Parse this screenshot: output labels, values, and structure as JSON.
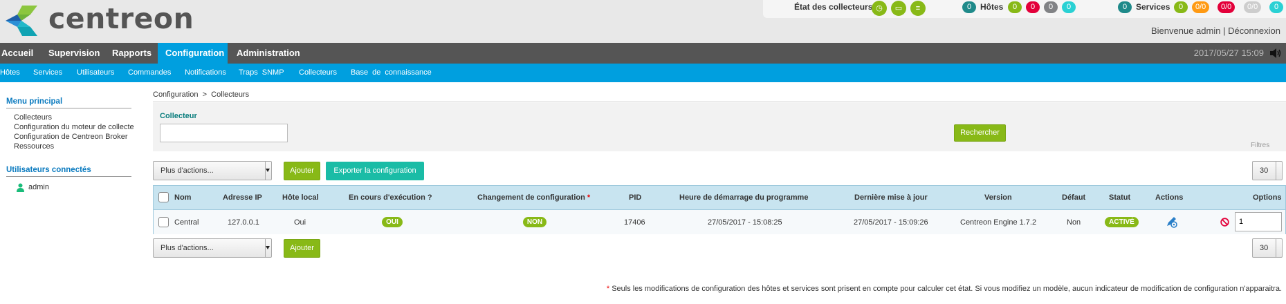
{
  "app": {
    "logo_text": "centreon"
  },
  "status": {
    "collectors_label": "État des collecteurs",
    "collector_icons": [
      "clock-icon",
      "inbox-icon",
      "database-icon"
    ],
    "hosts": {
      "label": "Hôtes",
      "total": "0",
      "up": "0",
      "down": "0",
      "unreachable": "0",
      "pending": "0"
    },
    "services": {
      "label": "Services",
      "total": "0",
      "ok": "0",
      "warning": "0/0",
      "critical": "0/0",
      "unknown": "0/0",
      "pending": "0"
    },
    "colors": {
      "green": "#88b917",
      "red": "#e3003a",
      "orange": "#ff9a13",
      "grey": "#818285",
      "light_grey": "#cdcdcd",
      "cyan": "#2ad1d4",
      "teal": "#1f8a8a"
    }
  },
  "user": {
    "welcome": "Bienvenue admin",
    "separator": "|",
    "logout": "Déconnexion"
  },
  "mainnav": {
    "items": [
      "Accueil",
      "Supervision",
      "Rapports",
      "Configuration",
      "Administration"
    ],
    "active": "Configuration",
    "datetime": "2017/05/27 15:09"
  },
  "subnav": {
    "items": [
      "Hôtes",
      "Services",
      "Utilisateurs",
      "Commandes",
      "Notifications",
      "Traps SNMP",
      "Collecteurs",
      "Base de connaissance"
    ]
  },
  "sidebar": {
    "menu_title": "Menu principal",
    "menu_items": [
      "Collecteurs",
      "Configuration du moteur de collecte",
      "Configuration de Centreon Broker",
      "Ressources"
    ],
    "users_title": "Utilisateurs connectés",
    "users": [
      "admin"
    ]
  },
  "breadcrumb": {
    "parent": "Configuration",
    "sep": ">",
    "current": "Collecteurs"
  },
  "filter": {
    "label": "Collecteur",
    "value": "",
    "search_button": "Rechercher",
    "filters_label": "Filtres"
  },
  "actions": {
    "more_actions": "Plus d'actions...",
    "add_button": "Ajouter",
    "export_button": "Exporter la configuration",
    "page_size": "30"
  },
  "table": {
    "headers": {
      "name": "Nom",
      "ip": "Adresse IP",
      "localhost": "Hôte local",
      "running": "En cours d'exécution ?",
      "config_change": "Changement de configuration",
      "pid": "PID",
      "start_time": "Heure de démarrage du programme",
      "last_update": "Dernière mise à jour",
      "version": "Version",
      "default": "Défaut",
      "status": "Statut",
      "actions": "Actions",
      "options": "Options"
    },
    "rows": [
      {
        "name": "Central",
        "ip": "127.0.0.1",
        "localhost": "Oui",
        "running": "OUI",
        "config_change": "NON",
        "pid": "17406",
        "start_time": "27/05/2017 - 15:08:25",
        "last_update": "27/05/2017 - 15:09:26",
        "version": "Centreon Engine 1.7.2",
        "default": "Non",
        "status": "ACTIVÉ",
        "option_value": "1"
      }
    ]
  },
  "footnote": {
    "star": "*",
    "text": "Seuls les modifications de configuration des hôtes et services sont prisent en compte pour calculer cet état. Si vous modifiez un modèle, aucun indicateur de modification de configuration n'apparaitra."
  }
}
